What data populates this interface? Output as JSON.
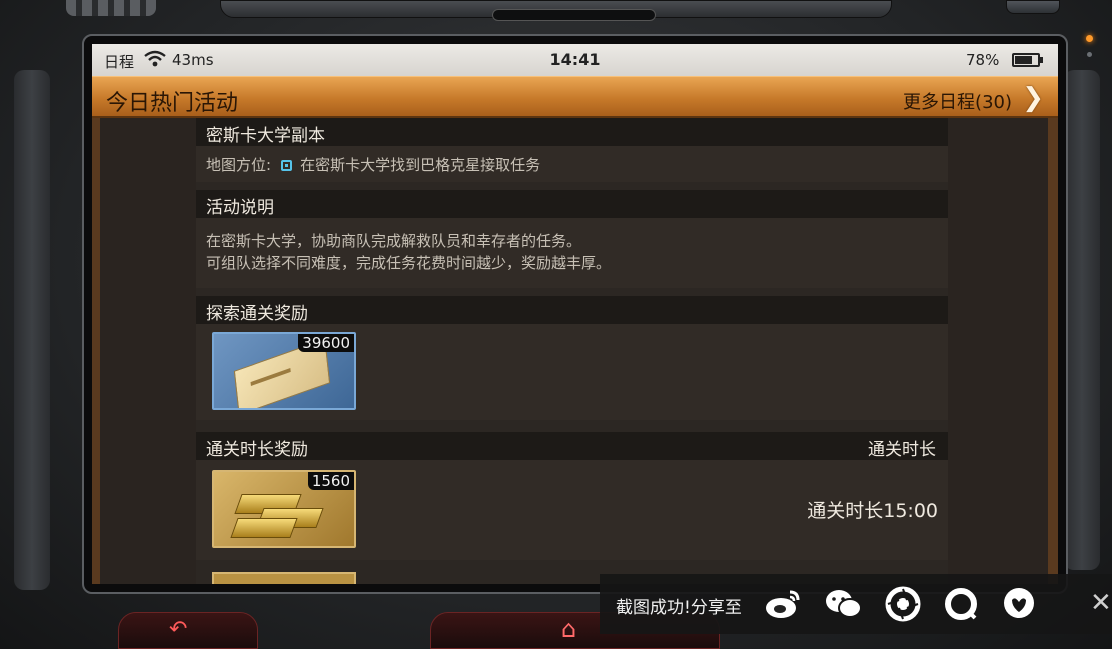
{
  "status_bar": {
    "carrier": "日程",
    "ping": "43ms",
    "time": "14:41",
    "battery_percent": "78%",
    "battery_level": 0.78
  },
  "header": {
    "title": "今日热门活动",
    "more_label": "更多日程(30)"
  },
  "dungeon": {
    "name": "密斯卡大学副本",
    "location_label": "地图方位:",
    "location_text": "在密斯卡大学找到巴格克星接取任务"
  },
  "description": {
    "heading": "活动说明",
    "lines": [
      "在密斯卡大学，协助商队完成解救队员和幸存者的任务。",
      "可组队选择不同难度，完成任务花费时间越少，奖励越丰厚。"
    ]
  },
  "explore_reward": {
    "heading": "探索通关奖励",
    "items": [
      {
        "icon": "ticket-icon",
        "quantity": "39600"
      }
    ]
  },
  "time_reward": {
    "heading": "通关时长奖励",
    "column_label": "通关时长",
    "rows": [
      {
        "icon": "gold-bars-icon",
        "quantity": "1560",
        "clear_time": "通关时长15:00"
      }
    ]
  },
  "share": {
    "label": "截图成功!分享至",
    "targets": [
      "weibo-icon",
      "wechat-icon",
      "moments-icon",
      "qzone-icon",
      "qq-icon"
    ]
  },
  "colors": {
    "header_orange": "#d08433",
    "location_icon": "#56c3ea",
    "item_border_gold": "#d6b673",
    "nav_red": "#ff5a5a"
  }
}
